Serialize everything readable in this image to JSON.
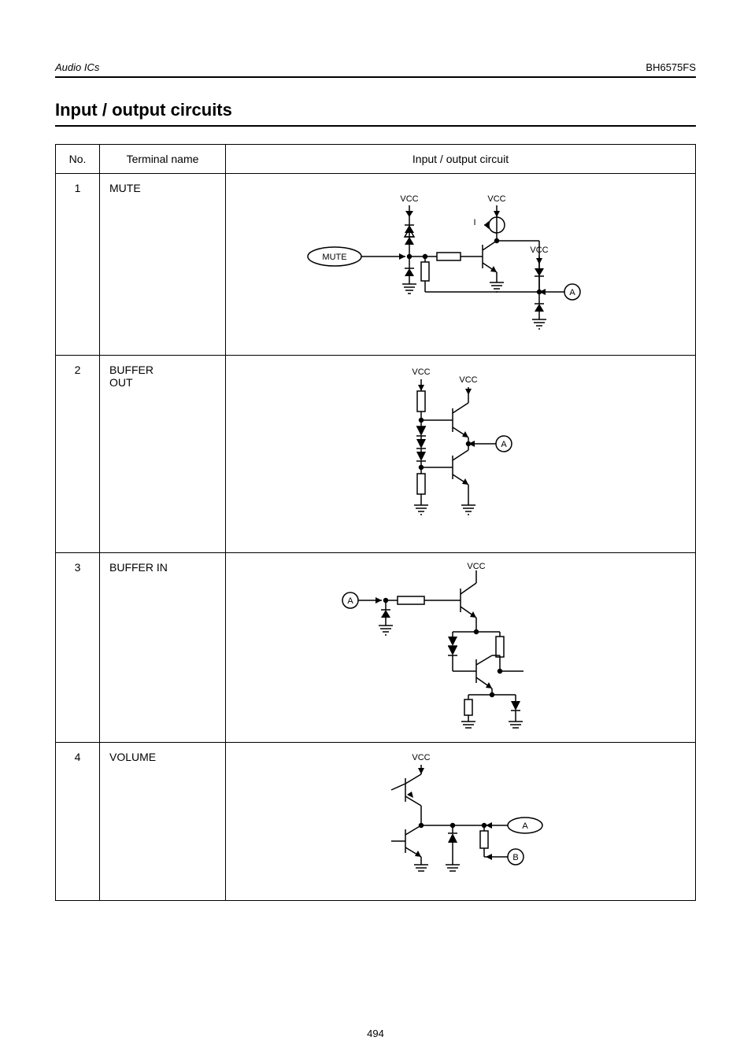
{
  "header": {
    "doc_id": "BH6575FS",
    "brand": "Audio ICs"
  },
  "section_title": "Input / output circuits",
  "columns": {
    "no": "No.",
    "name": "Terminal name",
    "circ": "Input / output circuit"
  },
  "rows": [
    {
      "no": "1",
      "name": "MUTE",
      "labels": {
        "l1": "MUTE",
        "l2": "VCC",
        "l3": "VCC",
        "l4": "I",
        "l5": "A"
      }
    },
    {
      "no": "2",
      "name": "BUFFER\nOUT",
      "labels": {
        "l1": "VCC",
        "l2": "VCC",
        "l3": "A"
      }
    },
    {
      "no": "3",
      "name": "BUFFER IN",
      "labels": {
        "l1": "VCC",
        "l2": "A"
      }
    },
    {
      "no": "4",
      "name": "VOLUME",
      "labels": {
        "l1": "VCC",
        "l2": "A",
        "l3": "B"
      }
    }
  ],
  "footer": "494"
}
